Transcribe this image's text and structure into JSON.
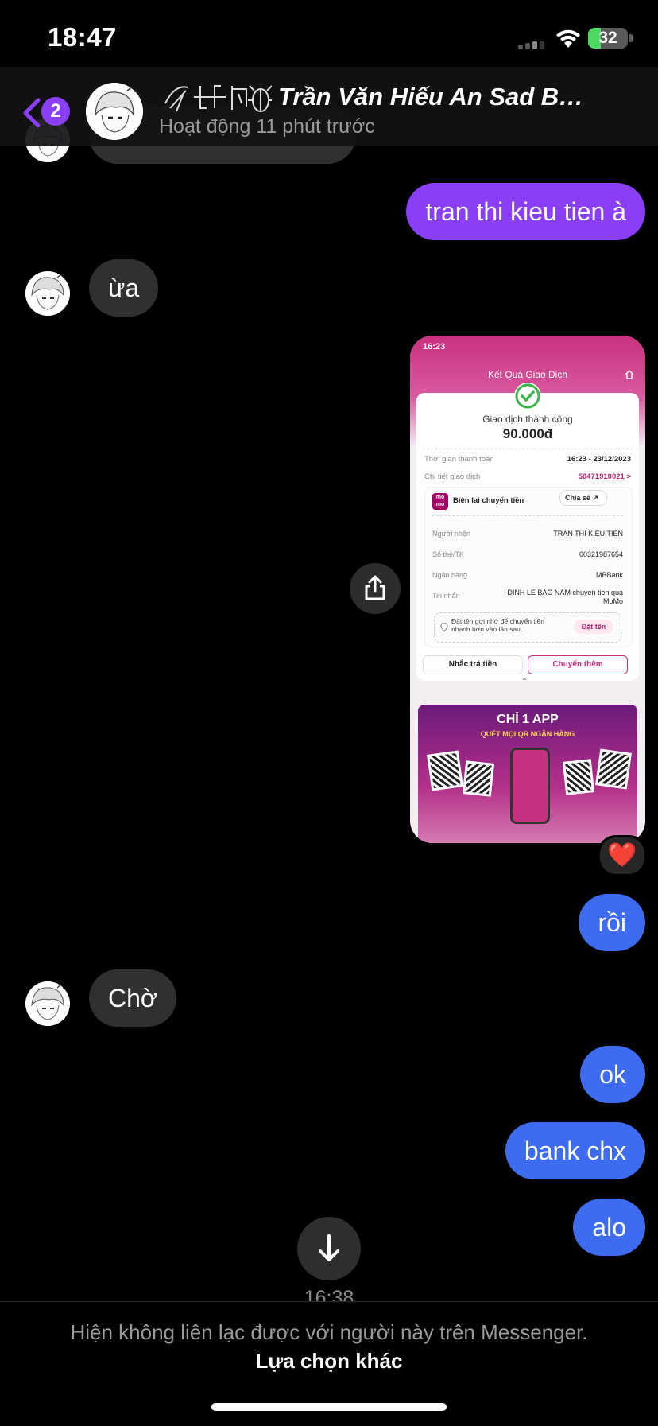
{
  "status_bar": {
    "time": "18:47",
    "battery": "32",
    "battery_level": 0.32
  },
  "header": {
    "back_badge": "2",
    "contact_name": "Trần Văn Hiếu An Sad Bo…",
    "activity": "Hoạt động 11 phút trước"
  },
  "messages": [
    {
      "id": "m1",
      "from": "me",
      "text": "tran thi kieu tien à",
      "color": "#8a3ff7"
    },
    {
      "id": "m2",
      "from": "them",
      "text": "ừa"
    },
    {
      "id": "m3",
      "from": "me",
      "type": "image",
      "reaction": "❤️"
    },
    {
      "id": "m4",
      "from": "me",
      "text": "rồi",
      "color": "#3d6cf0"
    },
    {
      "id": "m5",
      "from": "them",
      "text": "Chờ"
    },
    {
      "id": "m6",
      "from": "me",
      "text": "ok",
      "color": "#3d6cf0"
    },
    {
      "id": "m7",
      "from": "me",
      "text": "bank chx",
      "color": "#3d6cf0"
    },
    {
      "id": "m8",
      "from": "me",
      "text": "alo",
      "color": "#3d6cf0"
    }
  ],
  "receipt": {
    "time": "16:23",
    "title": "Kết Quả Giao Dịch",
    "success": "Giao dịch thành công",
    "amount": "90.000đ",
    "pay_time_label": "Thời gian thanh toán",
    "pay_time_value": "16:23 - 23/12/2023",
    "detail_label": "Chi tiết giao dịch",
    "detail_value": "50471910021 >",
    "receipt_label": "Biên lai chuyển tiền",
    "share_label": "Chia sẻ",
    "recipient_label": "Người nhận",
    "recipient_value": "TRAN THI KIEU TIEN",
    "account_label": "Số thẻ/TK",
    "account_value": "00321987654",
    "bank_label": "Ngân hàng",
    "bank_value": "MBBank",
    "message_label": "Tin nhắn",
    "message_value": "DINH LE BAO NAM chuyen tien qua MoMo",
    "nickname_hint": "Đặt tên gợi nhớ để chuyển tiền nhanh hơn vào lần sau.",
    "nickname_button": "Đặt tên",
    "remind_button": "Nhắc trả tiền",
    "transfer_more_button": "Chuyển thêm",
    "banner_title": "CHỈ 1 APP",
    "banner_sub": "QUÉT MỌI QR NGÂN HÀNG",
    "momo_logo": "mo mo"
  },
  "timestamp": "16:38",
  "footer": {
    "message": "Hiện không liên lạc được với người này trên Messenger.",
    "link": "Lựa chọn khác"
  },
  "icons": {
    "back": "chevron-left-icon",
    "share": "share-icon",
    "scroll_down": "arrow-down-icon",
    "wifi": "wifi-icon"
  }
}
